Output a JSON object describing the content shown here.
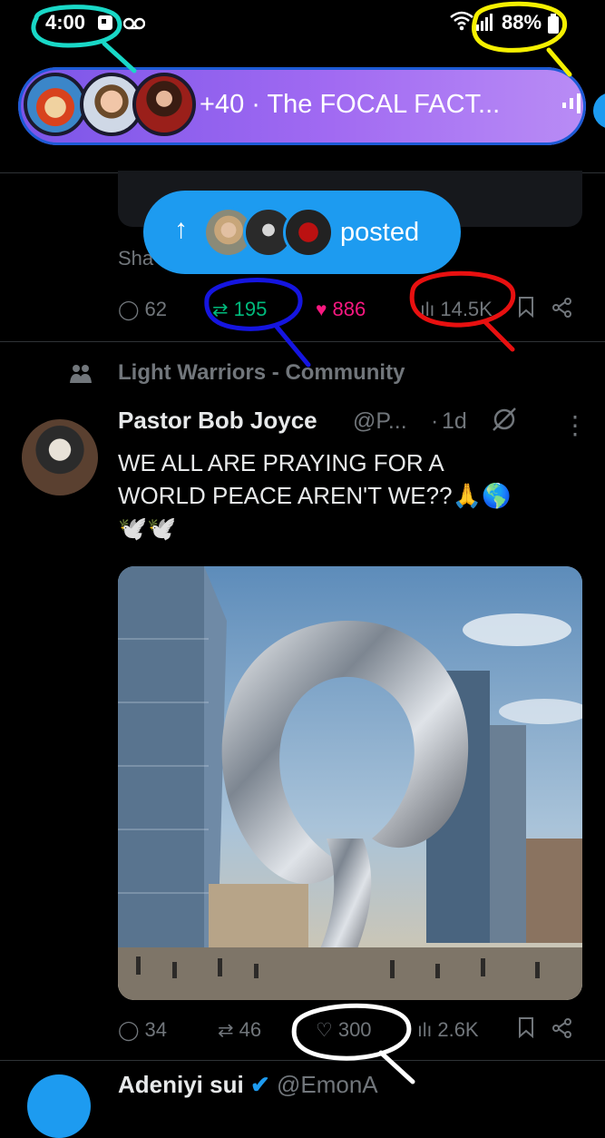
{
  "status_bar": {
    "time": "4:00",
    "battery": "88%"
  },
  "spaces_banner": {
    "title": "+40 · The FOCAL FACT..."
  },
  "previous_post": {
    "truncated_text": "Sha",
    "posted_pill": {
      "label": "posted",
      "arrow": "↑"
    },
    "actions": {
      "replies": "62",
      "reposts": "195",
      "likes": "886",
      "views": "14.5K"
    }
  },
  "tweet": {
    "community": "Light Warriors - Community",
    "author_name": "Pastor Bob Joyce",
    "author_handle": "@P...",
    "separator": "·",
    "time_ago": "1d",
    "text_line1": "WE ALL ARE PRAYING FOR A",
    "text_line2": "WORLD PEACE AREN'T WE??🙏🌎",
    "text_line3": "🕊️🕊️",
    "actions": {
      "replies": "34",
      "reposts": "46",
      "likes": "300",
      "views": "2.6K"
    }
  },
  "next_post": {
    "author_name": "Adeniyi sui",
    "author_handle": "@EmonA"
  },
  "colors": {
    "background": "#000000",
    "accent_blue": "#1d9bf0",
    "repost_green": "#00ba7c",
    "like_pink": "#f91880",
    "muted": "#71767b",
    "annotation_cyan": "#19d8c7",
    "annotation_yellow": "#f5f000",
    "annotation_blue": "#1515e0",
    "annotation_red": "#e81010",
    "annotation_white": "#ffffff"
  },
  "icons": [
    "voicemail-icon",
    "wifi-icon",
    "signal-icon",
    "battery-icon",
    "audio-bars-icon",
    "repost-icon",
    "reply-icon",
    "heart-icon",
    "views-icon",
    "bookmark-icon",
    "share-icon",
    "community-icon",
    "no-gravity-icon",
    "more-icon",
    "verified-icon"
  ]
}
